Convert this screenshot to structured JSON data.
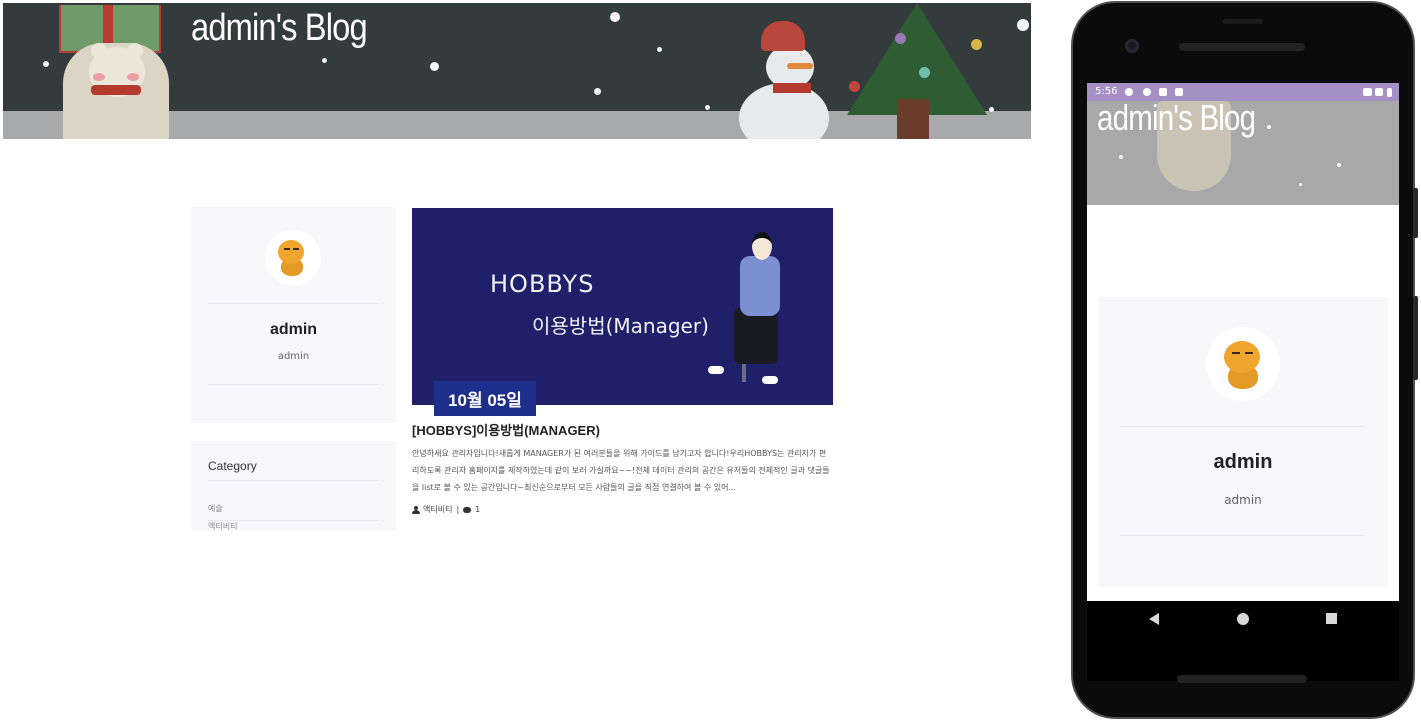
{
  "desktop": {
    "blog_title": "admin's Blog",
    "profile": {
      "name": "admin",
      "subtitle": "admin"
    },
    "category": {
      "title": "Category",
      "items": [
        "예술",
        "액티비티"
      ]
    },
    "post": {
      "image_text_line1": "HOBBYS",
      "image_text_line2": "이용방법(Manager)",
      "date": "10월 05일",
      "title": "[HOBBYS]이용방법(MANAGER)",
      "excerpt": "안녕하세요 관리자입니다!새롭게 MANAGER가 된 여러분들을 위해 가이드를 남기고자 합니다!우리HOBBYS는 관리자가 편리하도록 관리자 홈페이지를 제작하였는데 같이 보러 가실까요~~!전체 데이터 관리의 공간은 유저들의 전체적인 글과 댓글들을 list로 볼 수 있는 공간입니다~최신순으로부터 모든 사람들의 글을 직접 연결하여 볼 수 있어...",
      "category": "액티비티",
      "comment_count": "1"
    }
  },
  "mobile": {
    "status_time": "5:56",
    "blog_title": "admin's Blog",
    "profile": {
      "name": "admin",
      "subtitle": "admin"
    }
  },
  "colors": {
    "banner_bg": "#343b3d",
    "date_badge": "#1d2f8a",
    "post_image_bg": "#1f1f6a",
    "card_bg": "#f8f7fc",
    "status_bar": "#a590c4"
  }
}
